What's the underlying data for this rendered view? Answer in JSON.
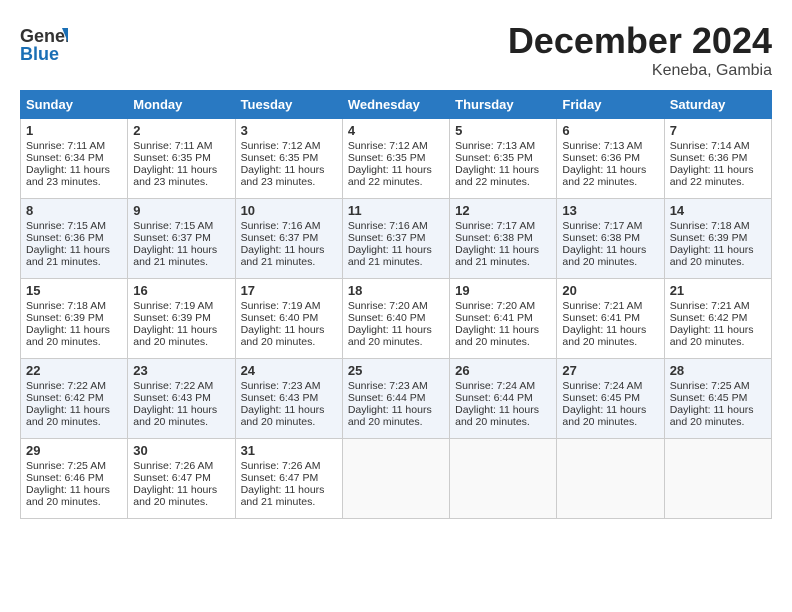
{
  "header": {
    "logo_line1": "General",
    "logo_line2": "Blue",
    "month": "December 2024",
    "location": "Keneba, Gambia"
  },
  "weekdays": [
    "Sunday",
    "Monday",
    "Tuesday",
    "Wednesday",
    "Thursday",
    "Friday",
    "Saturday"
  ],
  "weeks": [
    [
      {
        "day": "1",
        "sunrise": "7:11 AM",
        "sunset": "6:34 PM",
        "daylight": "11 hours and 23 minutes."
      },
      {
        "day": "2",
        "sunrise": "7:11 AM",
        "sunset": "6:35 PM",
        "daylight": "11 hours and 23 minutes."
      },
      {
        "day": "3",
        "sunrise": "7:12 AM",
        "sunset": "6:35 PM",
        "daylight": "11 hours and 23 minutes."
      },
      {
        "day": "4",
        "sunrise": "7:12 AM",
        "sunset": "6:35 PM",
        "daylight": "11 hours and 22 minutes."
      },
      {
        "day": "5",
        "sunrise": "7:13 AM",
        "sunset": "6:35 PM",
        "daylight": "11 hours and 22 minutes."
      },
      {
        "day": "6",
        "sunrise": "7:13 AM",
        "sunset": "6:36 PM",
        "daylight": "11 hours and 22 minutes."
      },
      {
        "day": "7",
        "sunrise": "7:14 AM",
        "sunset": "6:36 PM",
        "daylight": "11 hours and 22 minutes."
      }
    ],
    [
      {
        "day": "8",
        "sunrise": "7:15 AM",
        "sunset": "6:36 PM",
        "daylight": "11 hours and 21 minutes."
      },
      {
        "day": "9",
        "sunrise": "7:15 AM",
        "sunset": "6:37 PM",
        "daylight": "11 hours and 21 minutes."
      },
      {
        "day": "10",
        "sunrise": "7:16 AM",
        "sunset": "6:37 PM",
        "daylight": "11 hours and 21 minutes."
      },
      {
        "day": "11",
        "sunrise": "7:16 AM",
        "sunset": "6:37 PM",
        "daylight": "11 hours and 21 minutes."
      },
      {
        "day": "12",
        "sunrise": "7:17 AM",
        "sunset": "6:38 PM",
        "daylight": "11 hours and 21 minutes."
      },
      {
        "day": "13",
        "sunrise": "7:17 AM",
        "sunset": "6:38 PM",
        "daylight": "11 hours and 20 minutes."
      },
      {
        "day": "14",
        "sunrise": "7:18 AM",
        "sunset": "6:39 PM",
        "daylight": "11 hours and 20 minutes."
      }
    ],
    [
      {
        "day": "15",
        "sunrise": "7:18 AM",
        "sunset": "6:39 PM",
        "daylight": "11 hours and 20 minutes."
      },
      {
        "day": "16",
        "sunrise": "7:19 AM",
        "sunset": "6:39 PM",
        "daylight": "11 hours and 20 minutes."
      },
      {
        "day": "17",
        "sunrise": "7:19 AM",
        "sunset": "6:40 PM",
        "daylight": "11 hours and 20 minutes."
      },
      {
        "day": "18",
        "sunrise": "7:20 AM",
        "sunset": "6:40 PM",
        "daylight": "11 hours and 20 minutes."
      },
      {
        "day": "19",
        "sunrise": "7:20 AM",
        "sunset": "6:41 PM",
        "daylight": "11 hours and 20 minutes."
      },
      {
        "day": "20",
        "sunrise": "7:21 AM",
        "sunset": "6:41 PM",
        "daylight": "11 hours and 20 minutes."
      },
      {
        "day": "21",
        "sunrise": "7:21 AM",
        "sunset": "6:42 PM",
        "daylight": "11 hours and 20 minutes."
      }
    ],
    [
      {
        "day": "22",
        "sunrise": "7:22 AM",
        "sunset": "6:42 PM",
        "daylight": "11 hours and 20 minutes."
      },
      {
        "day": "23",
        "sunrise": "7:22 AM",
        "sunset": "6:43 PM",
        "daylight": "11 hours and 20 minutes."
      },
      {
        "day": "24",
        "sunrise": "7:23 AM",
        "sunset": "6:43 PM",
        "daylight": "11 hours and 20 minutes."
      },
      {
        "day": "25",
        "sunrise": "7:23 AM",
        "sunset": "6:44 PM",
        "daylight": "11 hours and 20 minutes."
      },
      {
        "day": "26",
        "sunrise": "7:24 AM",
        "sunset": "6:44 PM",
        "daylight": "11 hours and 20 minutes."
      },
      {
        "day": "27",
        "sunrise": "7:24 AM",
        "sunset": "6:45 PM",
        "daylight": "11 hours and 20 minutes."
      },
      {
        "day": "28",
        "sunrise": "7:25 AM",
        "sunset": "6:45 PM",
        "daylight": "11 hours and 20 minutes."
      }
    ],
    [
      {
        "day": "29",
        "sunrise": "7:25 AM",
        "sunset": "6:46 PM",
        "daylight": "11 hours and 20 minutes."
      },
      {
        "day": "30",
        "sunrise": "7:26 AM",
        "sunset": "6:47 PM",
        "daylight": "11 hours and 20 minutes."
      },
      {
        "day": "31",
        "sunrise": "7:26 AM",
        "sunset": "6:47 PM",
        "daylight": "11 hours and 21 minutes."
      },
      null,
      null,
      null,
      null
    ]
  ]
}
